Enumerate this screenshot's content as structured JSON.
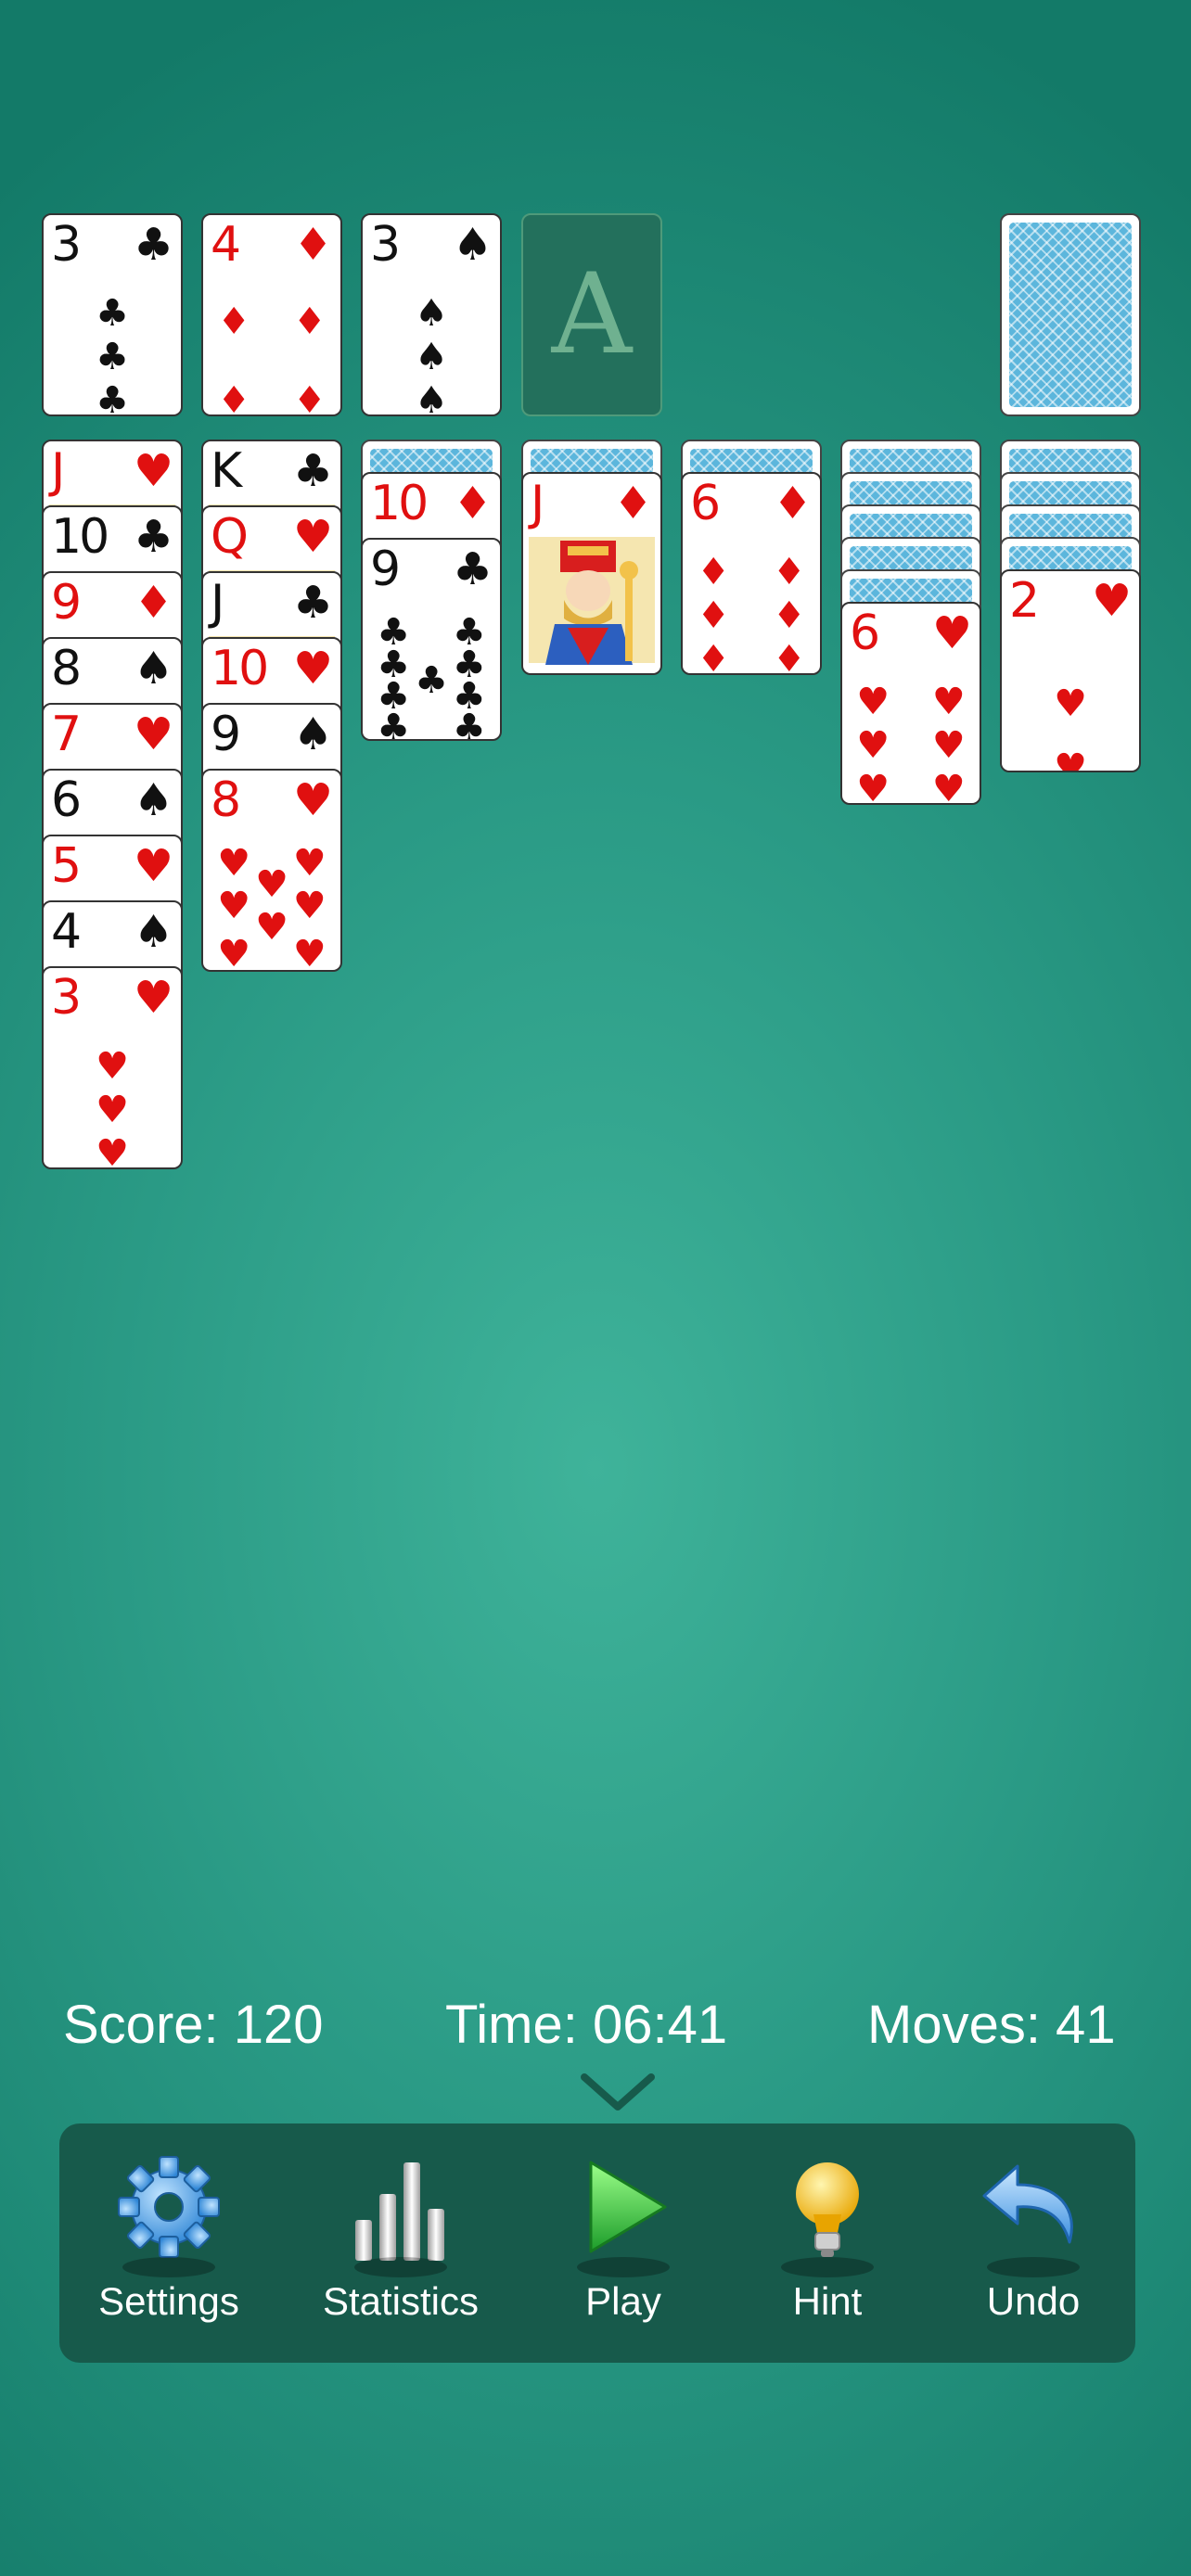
{
  "colors": {
    "felt": "#2a9a85",
    "toolbar": "#175a4b",
    "red_suit": "#e01010",
    "black_suit": "#111111",
    "card_back": "#5cb6dc"
  },
  "top_row": {
    "waste": [
      {
        "rank": "3",
        "suit": "clubs"
      },
      {
        "rank": "4",
        "suit": "diamonds"
      },
      {
        "rank": "3",
        "suit": "spades"
      }
    ],
    "foundation_placeholder": "A",
    "stock": "face-down"
  },
  "tableau": [
    {
      "hidden": 0,
      "cards": [
        {
          "rank": "J",
          "suit": "hearts"
        },
        {
          "rank": "10",
          "suit": "clubs"
        },
        {
          "rank": "9",
          "suit": "diamonds"
        },
        {
          "rank": "8",
          "suit": "spades"
        },
        {
          "rank": "7",
          "suit": "hearts"
        },
        {
          "rank": "6",
          "suit": "spades"
        },
        {
          "rank": "5",
          "suit": "hearts"
        },
        {
          "rank": "4",
          "suit": "spades"
        },
        {
          "rank": "3",
          "suit": "hearts"
        }
      ]
    },
    {
      "hidden": 0,
      "cards": [
        {
          "rank": "K",
          "suit": "clubs"
        },
        {
          "rank": "Q",
          "suit": "hearts"
        },
        {
          "rank": "J",
          "suit": "clubs"
        },
        {
          "rank": "10",
          "suit": "hearts"
        },
        {
          "rank": "9",
          "suit": "spades"
        },
        {
          "rank": "8",
          "suit": "hearts"
        }
      ]
    },
    {
      "hidden": 1,
      "cards": [
        {
          "rank": "10",
          "suit": "diamonds"
        },
        {
          "rank": "9",
          "suit": "clubs"
        }
      ]
    },
    {
      "hidden": 1,
      "cards": [
        {
          "rank": "J",
          "suit": "diamonds"
        }
      ]
    },
    {
      "hidden": 1,
      "cards": [
        {
          "rank": "6",
          "suit": "diamonds"
        }
      ]
    },
    {
      "hidden": 5,
      "cards": [
        {
          "rank": "6",
          "suit": "hearts"
        }
      ]
    },
    {
      "hidden": 4,
      "cards": [
        {
          "rank": "2",
          "suit": "hearts"
        }
      ]
    }
  ],
  "status": {
    "score": "Score: 120",
    "time": "Time: 06:41",
    "moves": "Moves: 41"
  },
  "toolbar": [
    {
      "label": "Settings",
      "icon": "gear-icon"
    },
    {
      "label": "Statistics",
      "icon": "bar-chart-icon"
    },
    {
      "label": "Play",
      "icon": "play-icon"
    },
    {
      "label": "Hint",
      "icon": "lightbulb-icon"
    },
    {
      "label": "Undo",
      "icon": "undo-icon"
    }
  ]
}
